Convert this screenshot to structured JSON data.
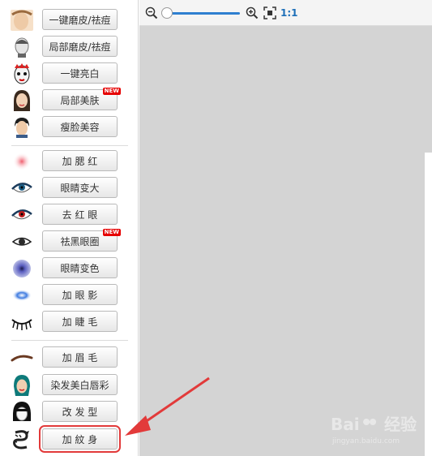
{
  "tools": [
    {
      "label": "一键磨皮/祛痘",
      "icon": "face-skin-smooth-icon",
      "badge": ""
    },
    {
      "label": "局部磨皮/祛痘",
      "icon": "face-partial-smooth-icon",
      "badge": ""
    },
    {
      "label": "一键亮白",
      "icon": "opera-mask-icon",
      "badge": ""
    },
    {
      "label": "局部美肤",
      "icon": "face-beauty-icon",
      "badge": "NEW"
    },
    {
      "label": "瘦脸美容",
      "icon": "face-slim-icon",
      "badge": ""
    },
    {
      "label": "加 腮 红",
      "icon": "blush-icon",
      "badge": ""
    },
    {
      "label": "眼睛变大",
      "icon": "eye-enlarge-icon",
      "badge": ""
    },
    {
      "label": "去 红 眼",
      "icon": "red-eye-icon",
      "badge": ""
    },
    {
      "label": "祛黑眼圈",
      "icon": "eye-circle-icon",
      "badge": "NEW"
    },
    {
      "label": "眼睛变色",
      "icon": "eye-color-icon",
      "badge": ""
    },
    {
      "label": "加 眼 影",
      "icon": "eye-shadow-icon",
      "badge": ""
    },
    {
      "label": "加 睫 毛",
      "icon": "eyelash-icon",
      "badge": ""
    },
    {
      "label": "加 眉 毛",
      "icon": "eyebrow-icon",
      "badge": ""
    },
    {
      "label": "染发美白唇彩",
      "icon": "hair-dye-icon",
      "badge": ""
    },
    {
      "label": "改 发 型",
      "icon": "hairstyle-icon",
      "badge": ""
    },
    {
      "label": "加 紋 身",
      "icon": "tattoo-dragon-icon",
      "badge": ""
    }
  ],
  "toolbar": {
    "zoom_ratio": "1:1",
    "zoom_level": 0.0
  },
  "watermark": {
    "brand": "Bai",
    "brand2": "经验",
    "url": "jingyan.baidu.com"
  },
  "colors": {
    "highlight": "#e23a3a",
    "accent": "#1d6fb8"
  }
}
